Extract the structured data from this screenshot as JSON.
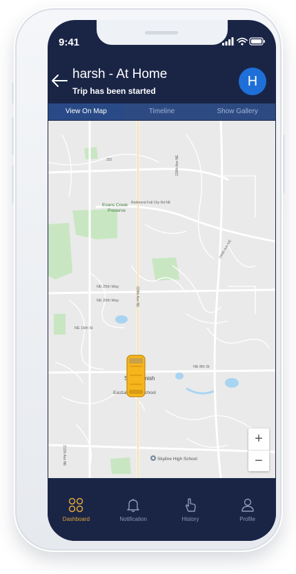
{
  "status": {
    "time": "9:41"
  },
  "header": {
    "title": "harsh - At Home",
    "subtitle": "Trip has been started",
    "avatar_initial": "H"
  },
  "tabs": [
    {
      "label": "View On Map"
    },
    {
      "label": "Timeline"
    },
    {
      "label": "Show Gallery"
    }
  ],
  "map": {
    "labels": {
      "preserve_1": "Evans Creek",
      "preserve_2": "Preserve",
      "fall_city": "Redmond Fall City Rd NE",
      "ave_238": "238th Ave NE",
      "ave_244": "244th Ave NE",
      "school": "Skyline High School",
      "eastlake": "Eastlake High School",
      "sammamish": "Sammamish",
      "way_1": "NE 25th Way",
      "way_2": "NE 20th Way",
      "st_16": "NE 16th St",
      "st_8": "NE 8th St",
      "ave_228": "228th Ave NE",
      "ave_212": "212th Ave NE",
      "route_202": "202"
    },
    "zoom_in": "+",
    "zoom_out": "−"
  },
  "nav": [
    {
      "label": "Dashboard"
    },
    {
      "label": "Notification"
    },
    {
      "label": "History"
    },
    {
      "label": "Profile"
    }
  ],
  "colors": {
    "nav_bg": "#1a2546",
    "accent": "#e0a53a",
    "avatar": "#1f6fd8",
    "tab_bg": "#2e4a82"
  }
}
